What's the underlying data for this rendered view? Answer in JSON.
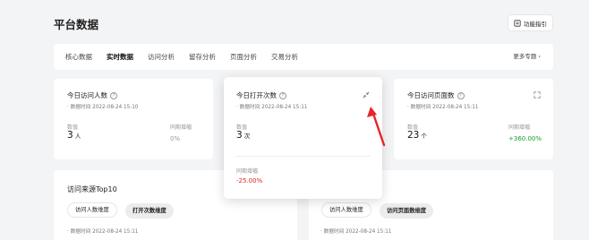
{
  "header": {
    "title": "平台数据",
    "guide_label": "功能指引"
  },
  "tabs": {
    "items": [
      {
        "label": "核心数据"
      },
      {
        "label": "实时数据"
      },
      {
        "label": "访问分析"
      },
      {
        "label": "留存分析"
      },
      {
        "label": "页面分析"
      },
      {
        "label": "交易分析"
      }
    ],
    "active_index": 1,
    "more_label": "更多专题"
  },
  "cards": {
    "visitors": {
      "label": "今日访问人数",
      "time": "· 数据时间 2022-08-24 15:10",
      "value_label": "数值",
      "value": "3",
      "unit": "人",
      "change_label": "同期增幅",
      "change": "0%"
    },
    "opens": {
      "label": "今日打开次数",
      "time": "· 数据时间 2022-08-24 15:11",
      "value_label": "数值",
      "value": "3",
      "unit": "次",
      "change_label": "同期增幅",
      "change": "-25.00%"
    },
    "pageviews": {
      "label": "今日访问页面数",
      "time": "· 数据时间 2022-08-24 15:11",
      "value_label": "数值",
      "value": "23",
      "unit": "个",
      "change_label": "同期增幅",
      "change": "+360.00%"
    }
  },
  "source": {
    "title": "访问来源Top10",
    "btn_users": "访问人数维度",
    "btn_opens": "打开次数维度",
    "time": "· 数据时间 2022-08-24 15:11"
  },
  "right_panel": {
    "btn_users": "访问人数维度",
    "btn_pages": "访问页面数维度",
    "time": "· 数据时间 2022-08-24 15:11"
  },
  "colors": {
    "negative": "#e02424",
    "positive": "#17a02c",
    "annotation_arrow": "#e5262a"
  }
}
